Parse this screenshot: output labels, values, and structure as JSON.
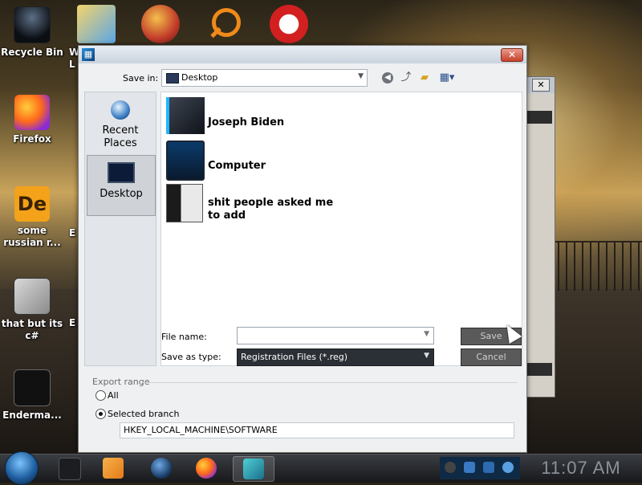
{
  "desktop": {
    "icons_left": [
      {
        "label": "Recycle Bin",
        "icon": "recycle-bin-icon"
      },
      {
        "label": "Firefox",
        "icon": "firefox-icon"
      },
      {
        "label": "some russian r...",
        "icon": "de-app-icon"
      },
      {
        "label": "that but its c#",
        "icon": "stacked-windows-icon"
      },
      {
        "label": "Enderma...",
        "icon": "list-app-icon"
      }
    ],
    "icons_top": [
      "folder-windows-icon",
      "p-app-icon",
      "magnifier-app-icon",
      "red-dragon-app-icon"
    ],
    "partial_label_top": "W",
    "partial_label_top2": "L",
    "partial_label_2": "E",
    "partial_label_3": "E"
  },
  "dialog": {
    "title_icon": "regedit-icon",
    "close_label": "✕",
    "save_in_label": "Save in:",
    "save_in_value": "Desktop",
    "toolbar_icons": [
      "back-icon",
      "up-folder-icon",
      "new-folder-icon",
      "view-menu-icon"
    ],
    "places": [
      {
        "label": "Recent Places",
        "icon": "recent-places-icon",
        "selected": false
      },
      {
        "label": "Desktop",
        "icon": "desktop-icon",
        "selected": true
      }
    ],
    "files": [
      {
        "name": "Joseph Biden",
        "icon": "user-folder-icon"
      },
      {
        "name": "Computer",
        "icon": "computer-icon"
      },
      {
        "name": "shit people asked me to add",
        "icon": "folder-icon"
      }
    ],
    "file_name_label": "File name:",
    "file_name_value": "",
    "save_as_type_label": "Save as type:",
    "save_as_type_value": "Registration Files (*.reg)",
    "save_button": "Save",
    "cancel_button": "Cancel",
    "export_range_label": "Export range",
    "radio_all": "All",
    "radio_selected": "Selected branch",
    "selected_option": "Selected branch",
    "branch_value": "HKEY_LOCAL_MACHINE\\SOFTWARE"
  },
  "back_window": {
    "close_label": "✕"
  },
  "taskbar": {
    "start_icon": "start-orb-icon",
    "items": [
      "file-manager-icon",
      "media-player-icon",
      "globe-icon",
      "firefox-icon",
      "regedit-icon"
    ],
    "active_item": "regedit-icon",
    "tray_icons": [
      "network-icon",
      "device-icon",
      "display-icon",
      "ie-icon"
    ],
    "clock": "11:07 AM"
  },
  "colors": {
    "taskbar": "#17181b",
    "dialog_bg": "#eef0f2",
    "dark_field": "#2b2f36",
    "disabled_button": "#5a5a5a"
  }
}
